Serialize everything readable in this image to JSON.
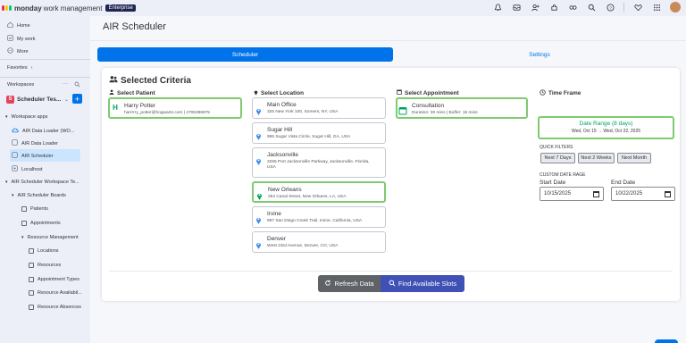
{
  "topbar": {
    "brand": "monday",
    "brand_sub": "work management",
    "plan_badge": "Enterprise",
    "icons": [
      "bell-icon",
      "inbox-icon",
      "invite-icon",
      "apps-icon",
      "integrations-icon",
      "search-icon",
      "help-icon",
      "heart-icon",
      "grid-icon"
    ]
  },
  "sidebar": {
    "nav": [
      {
        "label": "Home",
        "icon": "home-icon"
      },
      {
        "label": "My work",
        "icon": "my-work-icon"
      },
      {
        "label": "More",
        "icon": "more-icon"
      }
    ],
    "favorites": "Favorites",
    "workspaces": "Workspaces",
    "workspace_badge": "S",
    "workspace_name": "Scheduler Tes...",
    "section_apps": "Workspace apps",
    "apps": [
      "AIR Data Loader (WO...",
      "AIR Data Loader",
      "AIR Scheduler",
      "Localhost"
    ],
    "workspace_tree": "AIR Scheduler Workspace Te...",
    "boards_folder": "AIR Scheduler Boards",
    "boards": [
      "Patients",
      "Appointments"
    ],
    "resource_folder": "Resource Management",
    "resource_boards": [
      "Locations",
      "Resources",
      "Appointment Types",
      "Resource Availabil...",
      "Resource Absences"
    ]
  },
  "main": {
    "title": "AIR Scheduler",
    "tabs": {
      "scheduler": "Scheduler",
      "settings": "Settings"
    },
    "criteria_title": "Selected Criteria",
    "patient": {
      "heading": "Select Patient",
      "initial": "H",
      "name": "Harry Potter",
      "detail": "harrrrry_potter@hogwarts.com | 4705398875"
    },
    "location": {
      "heading": "Select Location",
      "items": [
        {
          "name": "Main Office",
          "address": "325 New York 100, Somers, NY, USA"
        },
        {
          "name": "Sugar Hill",
          "address": "986 Sugar Vista Circle, Sugar Hill, GA, USA"
        },
        {
          "name": "Jacksonville",
          "address": "3255 Port Jacksonville Parkway, Jacksonville, Florida, USA"
        },
        {
          "name": "New Orleans",
          "address": "254 Canal Street, New Orleans, LA, USA"
        },
        {
          "name": "Irvine",
          "address": "987 San Diego Creek Trail, Irvine, California, USA"
        },
        {
          "name": "Denver",
          "address": "West 23rd Avenue, Denver, CO, USA"
        }
      ]
    },
    "appointment": {
      "heading": "Select Appointment",
      "name": "Consultation",
      "detail": "Duration: 30 mins | Buffer: 15 mins"
    },
    "timeframe": {
      "heading": "Time Frame",
      "range_title": "Date Range (8 days)",
      "range_sub": "Wed, Oct 15 → Wed, Oct 22, 2025",
      "quick_filters_label": "QUICK FILTERS",
      "quick_filters": [
        "Next 7 Days",
        "Next 2 Weeks",
        "Next Month"
      ],
      "custom_label": "CUSTOM DATE RAGE",
      "start_label": "Start Date",
      "end_label": "End Date",
      "start_value": "10/15/2025",
      "end_value": "10/22/2025"
    },
    "actions": {
      "refresh": "Refresh Data",
      "find": "Find Available Slots"
    }
  },
  "colors": {
    "accent": "#0073ea",
    "selected_border": "#7ecb6f",
    "find_button": "#3f51b5",
    "refresh_button": "#5f6368",
    "location_selected": "#00a35c"
  }
}
